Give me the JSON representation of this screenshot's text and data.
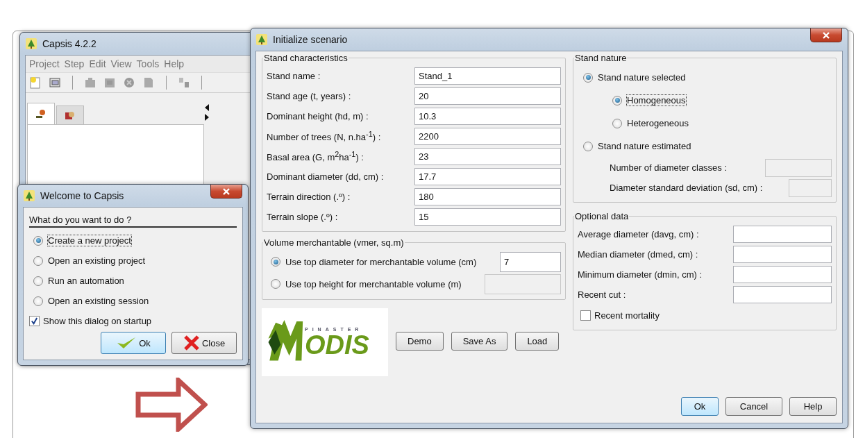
{
  "capsis_window": {
    "title": "Capsis 4.2.2",
    "menu": [
      "Project",
      "Step",
      "Edit",
      "View",
      "Tools",
      "Help"
    ],
    "tabs": [
      {
        "selected": true
      },
      {
        "selected": false
      }
    ]
  },
  "welcome_dialog": {
    "title": "Welcome to Capsis",
    "prompt": "What do you want to do ?",
    "options": [
      {
        "label": "Create a new project",
        "selected": true,
        "focused": true
      },
      {
        "label": "Open an existing project",
        "selected": false,
        "focused": false
      },
      {
        "label": "Run an automation",
        "selected": false,
        "focused": false
      },
      {
        "label": "Open an existing session",
        "selected": false,
        "focused": false
      }
    ],
    "show_on_startup": {
      "label": "Show this dialog on startup",
      "checked": true
    },
    "buttons": [
      {
        "label": "Ok",
        "kind": "ok",
        "default": true
      },
      {
        "label": "Close",
        "kind": "close",
        "default": false
      }
    ]
  },
  "scenario_dialog": {
    "title": "Initialize scenario",
    "stand_characteristics": {
      "title": "Stand characteristics",
      "rows": [
        {
          "label": "Stand name :",
          "value": "Stand_1"
        },
        {
          "label": "Stand age (t, years) :",
          "value": "20"
        },
        {
          "label": "Dominant height (hd, m) :",
          "value": "10.3"
        },
        {
          "label": "Number of trees (N, n.ha$^{-1}$) :",
          "value": "2200"
        },
        {
          "label": "Basal area (G, m$^{2}$ha$^{-1}$) :",
          "value": "23"
        },
        {
          "label": "Dominant diameter (dd, cm) :",
          "value": "17.7"
        },
        {
          "label": "Terrain direction (.º) :",
          "value": "180"
        },
        {
          "label": "Terrain slope (.º) :",
          "value": "15"
        }
      ]
    },
    "volume_merchantable": {
      "title": "Volume merchantable (vmer, sq.m)",
      "options": [
        {
          "label": "Use top diameter for merchantable volume (cm)",
          "selected": true,
          "value": "7",
          "disabled": false
        },
        {
          "label": "Use top height for merchantable volume (m)",
          "selected": false,
          "disabled": true
        }
      ]
    },
    "logo": {
      "tagline": "PINASTER",
      "wordmark": "ODIS"
    },
    "actions": [
      "Demo",
      "Save As",
      "Load"
    ],
    "stand_nature": {
      "title": "Stand nature",
      "options": [
        {
          "label": "Stand nature selected",
          "selected": true,
          "focused": false,
          "children": [
            {
              "label": "Homogeneous",
              "selected": true,
              "focused": true
            },
            {
              "label": "Heterogeneous",
              "selected": false,
              "focused": false
            }
          ]
        },
        {
          "label": "Stand nature estimated",
          "selected": false,
          "focused": false,
          "fields": [
            {
              "label": "Number of diameter classes :",
              "disabled": true
            },
            {
              "label": "Diameter standard deviation (sd, cm) :",
              "disabled": true
            }
          ]
        }
      ]
    },
    "optional_data": {
      "title": "Optional data",
      "fields": [
        {
          "label": "Average diameter (davg, cm) :"
        },
        {
          "label": "Median diameter (dmed, cm) :"
        },
        {
          "label": "Minimum diameter (dmin, cm) :"
        },
        {
          "label": "Recent cut :"
        }
      ],
      "checkbox": {
        "label": "Recent mortality",
        "checked": false
      }
    },
    "buttons": [
      {
        "label": "Ok",
        "default": true
      },
      {
        "label": "Cancel",
        "default": false
      },
      {
        "label": "Help",
        "default": false
      }
    ]
  }
}
